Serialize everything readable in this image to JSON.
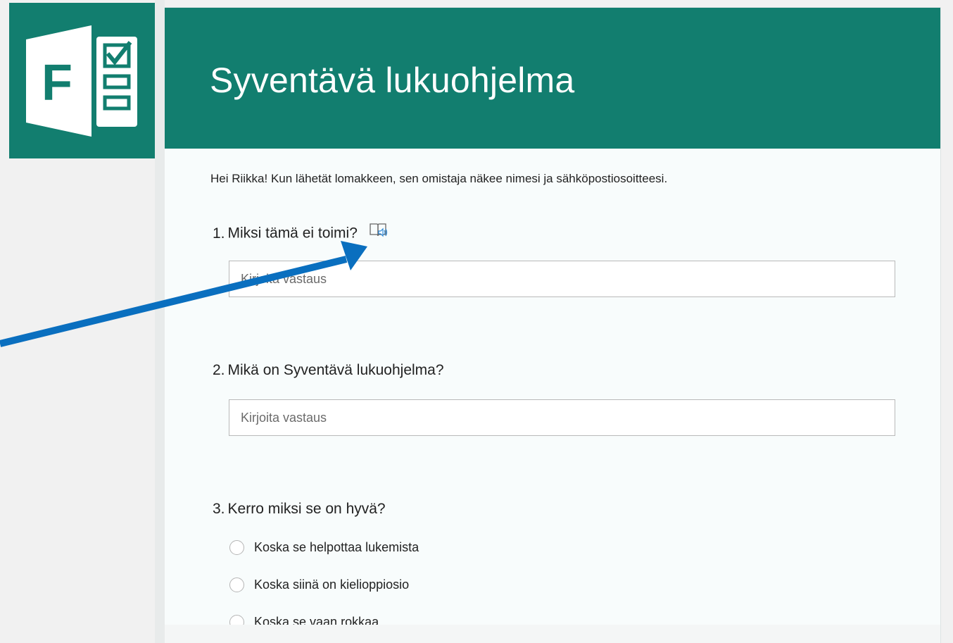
{
  "form": {
    "title": "Syventävä lukuohjelma",
    "notice": "Hei Riikka! Kun lähetät lomakkeen, sen omistaja näkee nimesi ja sähköpostiosoitteesi.",
    "brand_color": "#127e6f",
    "logo_letter": "F"
  },
  "questions": [
    {
      "number": "1.",
      "text": "Miksi tämä ei toimi?",
      "placeholder": "Kirjoita vastaus",
      "has_reader_icon": true
    },
    {
      "number": "2.",
      "text": "Mikä on Syventävä lukuohjelma?",
      "placeholder": "Kirjoita vastaus"
    },
    {
      "number": "3.",
      "text": "Kerro miksi se on hyvä?",
      "options": [
        "Koska se helpottaa lukemista",
        "Koska siinä on kielioppiosio",
        "Koska se vaan rokkaa"
      ]
    }
  ],
  "annotation": {
    "arrow_color": "#0a6fbf",
    "points_to": "immersive-reader-icon"
  }
}
